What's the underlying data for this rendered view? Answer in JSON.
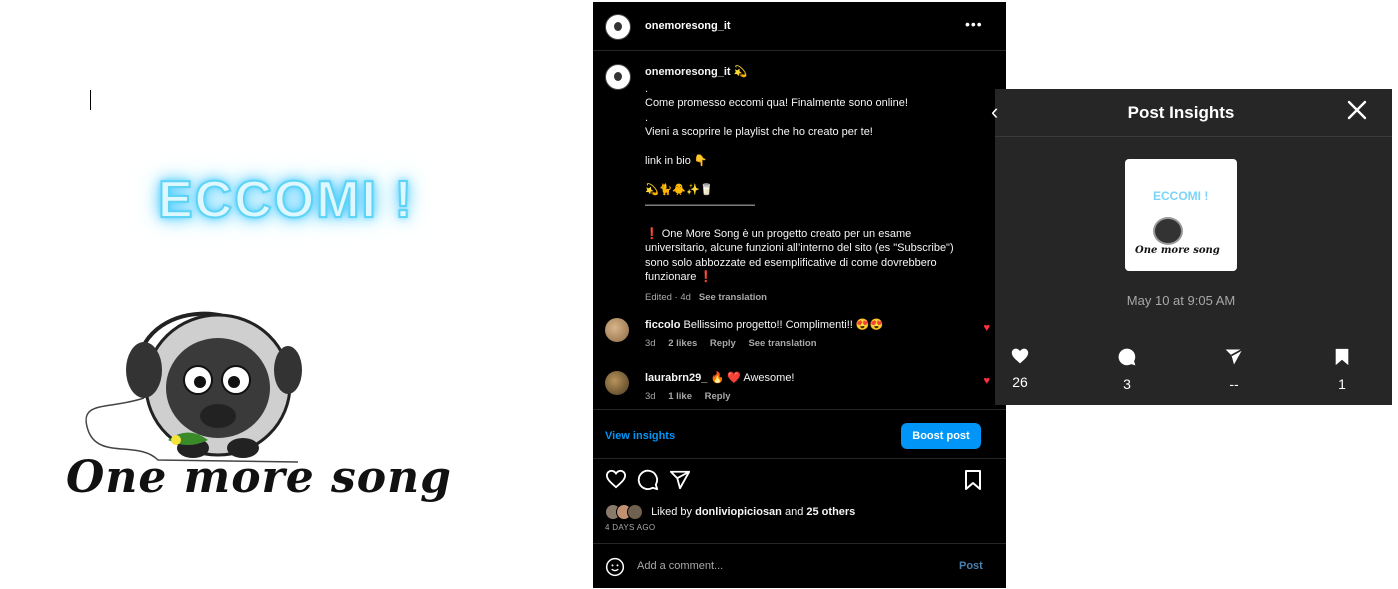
{
  "image": {
    "headline": "ECCOMI !",
    "brand": "One more song"
  },
  "post": {
    "username": "onemoresong_it",
    "more_icon": "more-horizontal-icon",
    "caption": {
      "author": "onemoresong_it",
      "author_emoji": "💫",
      "lines": [
        ".",
        "Come promesso eccomi qua! Finalmente sono online!",
        ".",
        "Vieni a scoprire le playlist che ho creato per te!",
        "",
        "link in bio 👇",
        "",
        "💫🐈🐥✨🥛",
        "——————————",
        "",
        "❗ One More Song è un progetto creato per un esame universitario, alcune funzioni all’interno del sito (es \"Subscribe\") sono solo abbozzate ed esemplificative di come dovrebbero funzionare ❗"
      ],
      "edited": "Edited · 4d",
      "see_translation": "See translation"
    },
    "comments": [
      {
        "user": "ficcolo",
        "text": "Bellissimo progetto!! Complimenti!! 😍😍",
        "time": "3d",
        "likes": "2 likes",
        "reply": "Reply",
        "translation": "See translation"
      },
      {
        "user": "laurabrn29_",
        "text": "🔥 ❤️ Awesome!",
        "time": "3d",
        "likes": "1 like",
        "reply": "Reply"
      }
    ],
    "view_insights": "View insights",
    "boost_post": "Boost post",
    "liked_by_prefix": "Liked by",
    "liked_by_user": "donliviopiciosan",
    "liked_by_and": "and",
    "liked_by_others": "25 others",
    "time_ago": "4 DAYS AGO",
    "add_comment_placeholder": "Add a comment...",
    "post_button": "Post"
  },
  "insights": {
    "title": "Post Insights",
    "date": "May 10 at 9:05 AM",
    "thumb_headline": "ECCOMI !",
    "thumb_brand": "One more song",
    "stats": [
      {
        "icon": "heart-icon",
        "value": "26"
      },
      {
        "icon": "comment-icon",
        "value": "3"
      },
      {
        "icon": "share-icon",
        "value": "--"
      },
      {
        "icon": "bookmark-icon",
        "value": "1"
      }
    ]
  },
  "colors": {
    "accent": "#0095f6",
    "like_red": "#ff3040",
    "panel_dark": "#262626"
  }
}
